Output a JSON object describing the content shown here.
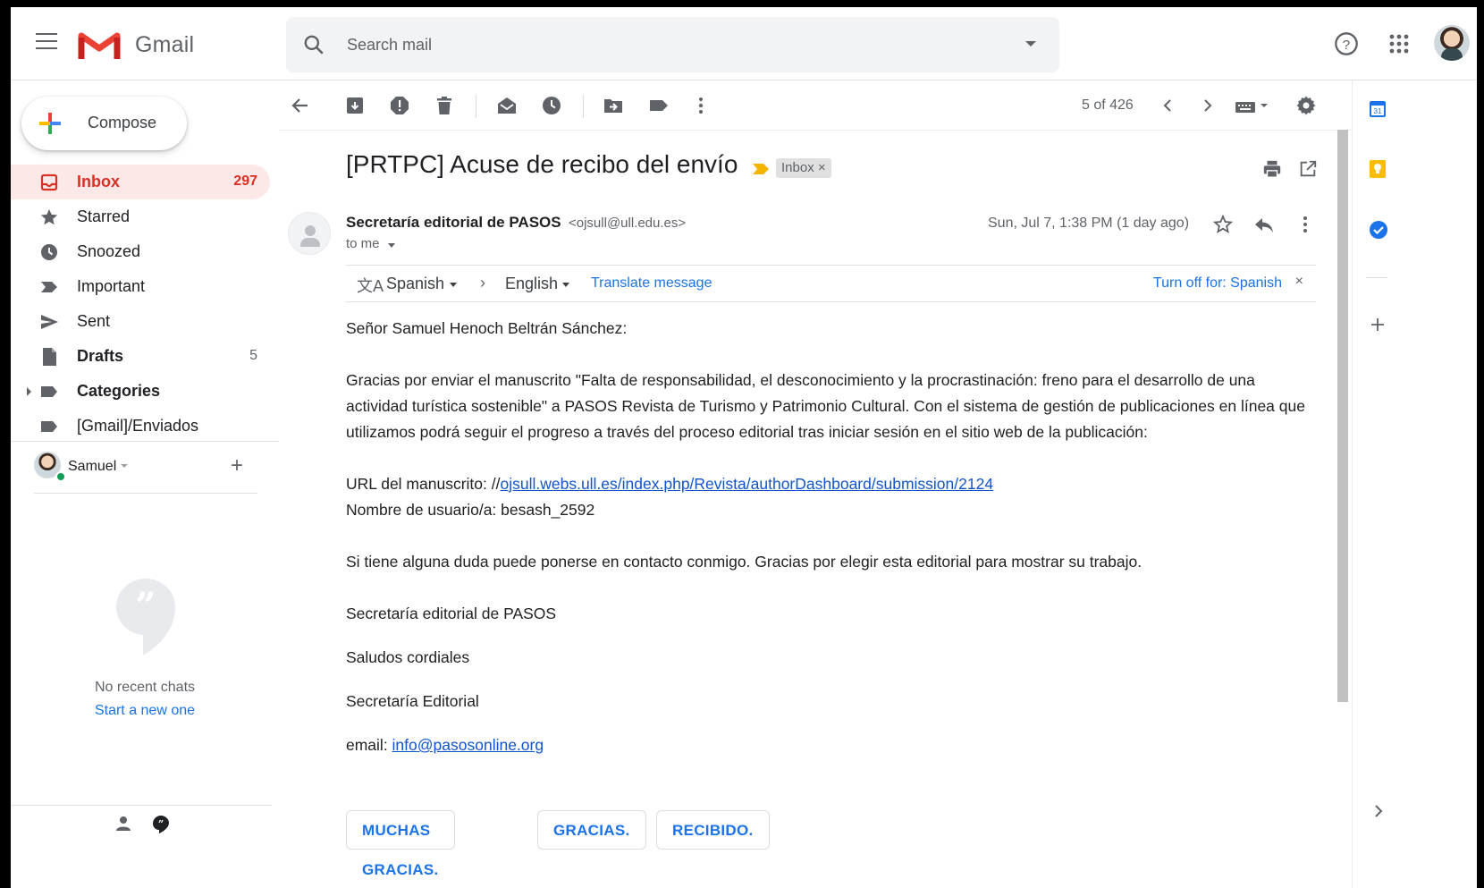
{
  "app": {
    "name": "Gmail"
  },
  "search": {
    "placeholder": "Search mail"
  },
  "compose": {
    "label": "Compose"
  },
  "nav": {
    "items": [
      {
        "label": "Inbox",
        "count": "297"
      },
      {
        "label": "Starred",
        "count": ""
      },
      {
        "label": "Snoozed",
        "count": ""
      },
      {
        "label": "Important",
        "count": ""
      },
      {
        "label": "Sent",
        "count": ""
      },
      {
        "label": "Drafts",
        "count": "5"
      },
      {
        "label": "Categories",
        "count": ""
      },
      {
        "label": "[Gmail]/Enviados",
        "count": ""
      }
    ]
  },
  "hangouts": {
    "user": "Samuel",
    "no_chats": "No recent chats",
    "start_new": "Start a new one"
  },
  "toolbar": {
    "pager": "5 of 426"
  },
  "message": {
    "subject": "[PRTPC] Acuse de recibo del envío",
    "label_chip": "Inbox",
    "label_chip_x": "×",
    "sender_name": "Secretaría editorial de PASOS",
    "sender_email": "<ojsull@ull.edu.es>",
    "to": "to me",
    "date": "Sun, Jul 7, 1:38 PM (1 day ago)"
  },
  "translate": {
    "from": "Spanish",
    "to": "English",
    "link": "Translate message",
    "turn_off": "Turn off for: Spanish",
    "close": "×"
  },
  "body": {
    "greeting": "Señor Samuel Henoch Beltrán Sánchez:",
    "para1": "Gracias por enviar el manuscrito \"Falta de responsabilidad, el desconocimiento y la procrastinación: freno para el desarrollo de una actividad turística sostenible\" a PASOS Revista de Turismo y Patrimonio Cultural. Con el sistema de gestión de publicaciones en línea que utilizamos podrá seguir el progreso a través del proceso editorial tras iniciar sesión en el sitio web de la publicación:",
    "url_label": "URL del manuscrito: //",
    "url_link": "ojsull.webs.ull.es/index.php/Revista/authorDashboard/submission/2124",
    "username": "Nombre de usuario/a: besash_2592",
    "contact": "Si tiene alguna duda puede ponerse en contacto conmigo. Gracias por elegir esta editorial para mostrar su trabajo.",
    "sig1": "Secretaría editorial de PASOS",
    "sig2": "Saludos cordiales",
    "sig3": "Secretaría Editorial",
    "email_label": "email: ",
    "email_link": "info@pasosonline.org"
  },
  "smart_replies": [
    "MUCHAS GRACIAS.",
    "GRACIAS.",
    "RECIBIDO."
  ],
  "colors": {
    "accent_red": "#d93025",
    "active_bg": "#fce8e6",
    "link_blue": "#1a73e8"
  }
}
